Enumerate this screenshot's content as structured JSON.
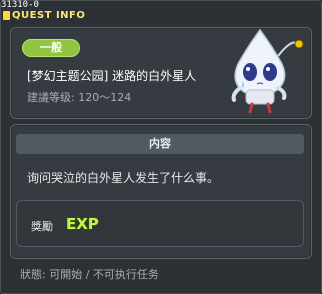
{
  "window": {
    "quest_id": "31310-0",
    "title": "QUEST INFO"
  },
  "quest": {
    "category": "一般",
    "name": "[梦幻主题公园] 迷路的白外星人",
    "level": "建議等级: 120～124"
  },
  "content": {
    "header": "内容",
    "description": "询问哭泣的白外星人发生了什么事。"
  },
  "reward": {
    "label": "獎勵",
    "exp_text": "EXP"
  },
  "status": {
    "text": "狀態: 可開始 / 不可执行任务"
  },
  "colors": {
    "badge": "#8fc540",
    "exp": "#c8f24a",
    "title": "#ffe870"
  },
  "icons": [
    "quest-title-icon",
    "alien-mascot",
    "exp-icon"
  ]
}
